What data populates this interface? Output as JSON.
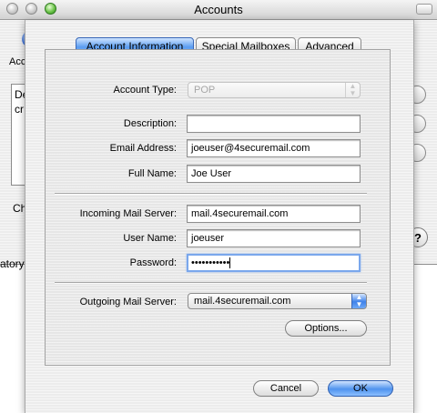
{
  "window": {
    "title": "Accounts"
  },
  "background": {
    "toolbar_label": "Acc",
    "list_rows": [
      "De",
      "cr"
    ],
    "checkbox_label": "Ch",
    "bottom_text": "atory"
  },
  "tabs": [
    {
      "label": "Account Information",
      "active": true
    },
    {
      "label": "Special Mailboxes",
      "active": false
    },
    {
      "label": "Advanced",
      "active": false
    }
  ],
  "form": {
    "account_type": {
      "label": "Account Type:",
      "value": "POP",
      "enabled": false
    },
    "description": {
      "label": "Description:",
      "value": ""
    },
    "email_address": {
      "label": "Email Address:",
      "value": "joeuser@4securemail.com"
    },
    "full_name": {
      "label": "Full Name:",
      "value": "Joe User"
    },
    "incoming_server": {
      "label": "Incoming Mail Server:",
      "value": "mail.4securemail.com"
    },
    "user_name": {
      "label": "User Name:",
      "value": "joeuser"
    },
    "password": {
      "label": "Password:",
      "value": "•••••••••••"
    },
    "outgoing_server": {
      "label": "Outgoing Mail Server:",
      "value": "mail.4securemail.com"
    },
    "options_label": "Options..."
  },
  "buttons": {
    "cancel": "Cancel",
    "ok": "OK"
  },
  "colors": {
    "accent_blue": "#5a9cf0",
    "focus_ring": "#7aa7ec"
  }
}
